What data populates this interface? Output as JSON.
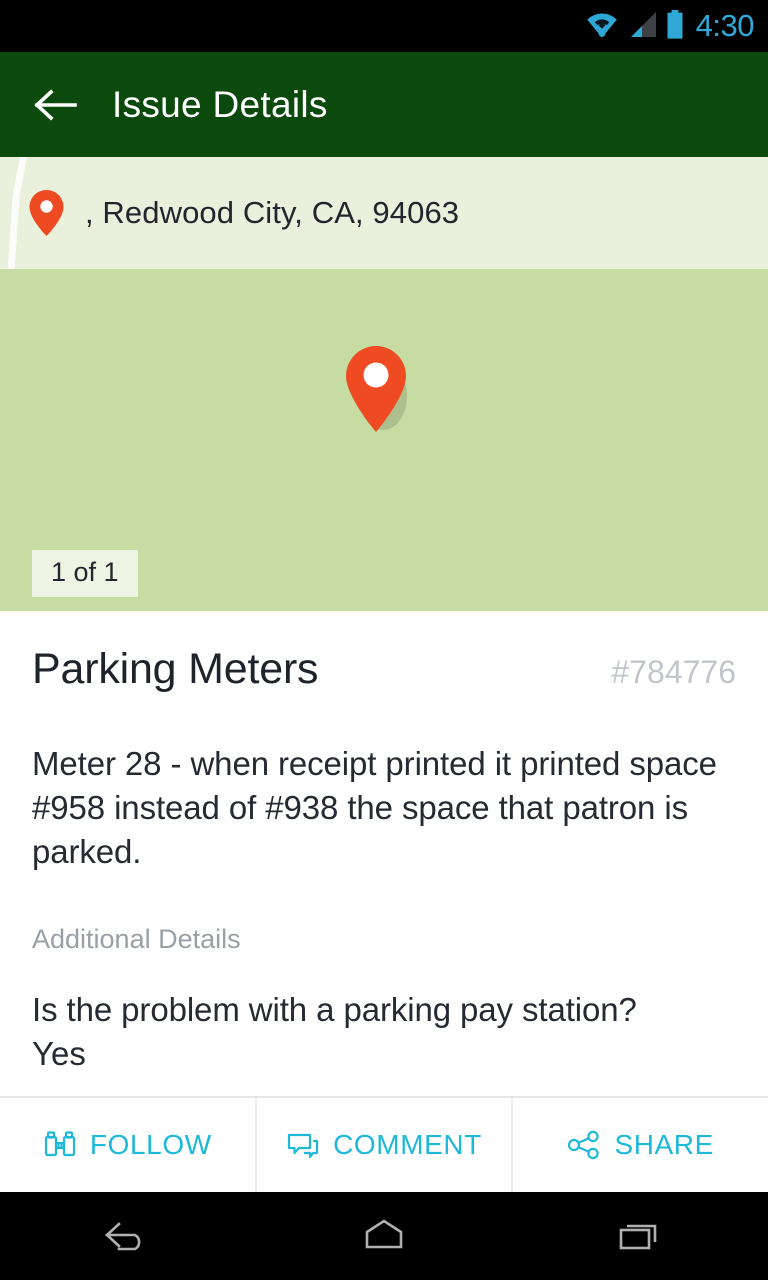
{
  "status_bar": {
    "time": "4:30",
    "icons": [
      "wifi-icon",
      "cellular-signal-icon",
      "battery-icon"
    ],
    "accent_color": "#2fa8d8",
    "background": "#000000"
  },
  "app_bar": {
    "back_icon": "back-arrow-icon",
    "title": "Issue Details",
    "background": "#0b4a0c",
    "text_color": "#ffffff"
  },
  "address": {
    "pin_icon": "location-pin-icon",
    "text": ", Redwood City, CA, 94063",
    "background": "#e9f0dc"
  },
  "map": {
    "pin_icon": "location-pin-icon",
    "pin_color": "#ee4b22",
    "background": "#c6dca2",
    "badge": "1 of 1"
  },
  "issue": {
    "title": "Parking Meters",
    "id": "#784776",
    "description": "Meter 28 - when receipt printed it printed space #958 instead of #938 the space that patron is parked.",
    "additional_details_label": "Additional Details",
    "questions": [
      {
        "question": "Is the problem with a parking pay station?",
        "answer": "Yes"
      }
    ]
  },
  "actions": {
    "accent_color": "#1eb8d8",
    "buttons": [
      {
        "icon": "binoculars-icon",
        "label": "FOLLOW"
      },
      {
        "icon": "comment-bubbles-icon",
        "label": "COMMENT"
      },
      {
        "icon": "share-nodes-icon",
        "label": "SHARE"
      }
    ]
  },
  "nav_bar": {
    "buttons": [
      "back-nav-icon",
      "home-nav-icon",
      "recents-nav-icon"
    ],
    "background": "#000000",
    "icon_color": "#b0b0b0"
  }
}
